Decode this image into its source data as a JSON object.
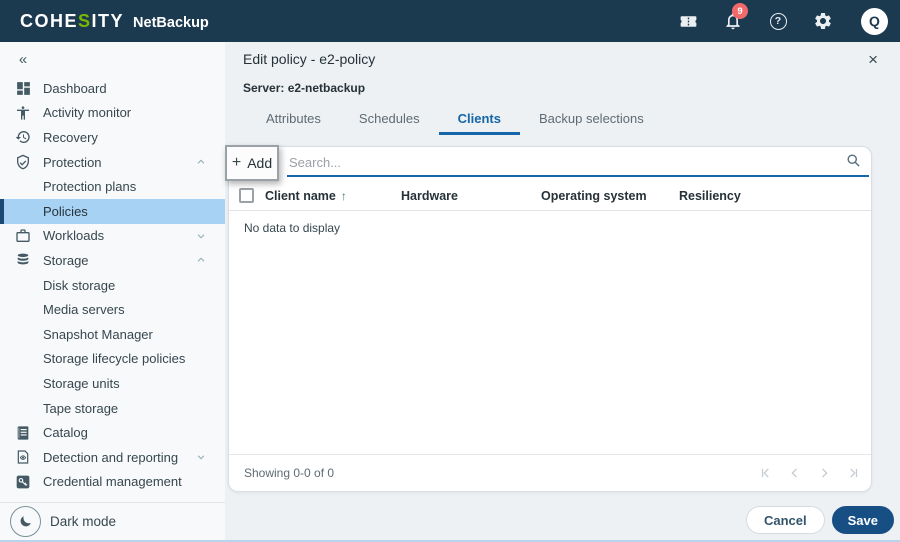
{
  "icons": {
    "collapse": "«",
    "sort_asc": "↑",
    "close": "×",
    "plus": "+",
    "help": "?"
  },
  "topbar": {
    "brand_pre": "COHE",
    "brand_s": "S",
    "brand_post": "ITY",
    "product": "NetBackup",
    "notification_count": "9",
    "avatar_initial": "Q"
  },
  "sidebar": {
    "items": [
      {
        "label": "Dashboard"
      },
      {
        "label": "Activity monitor"
      },
      {
        "label": "Recovery"
      },
      {
        "label": "Protection"
      },
      {
        "label": "Protection plans"
      },
      {
        "label": "Policies"
      },
      {
        "label": "Workloads"
      },
      {
        "label": "Storage"
      },
      {
        "label": "Disk storage"
      },
      {
        "label": "Media servers"
      },
      {
        "label": "Snapshot Manager"
      },
      {
        "label": "Storage lifecycle policies"
      },
      {
        "label": "Storage units"
      },
      {
        "label": "Tape storage"
      },
      {
        "label": "Catalog"
      },
      {
        "label": "Detection and reporting"
      },
      {
        "label": "Credential management"
      }
    ],
    "dark_mode_label": "Dark mode"
  },
  "panel": {
    "title": "Edit policy - e2-policy",
    "server": "Server: e2-netbackup",
    "tabs": [
      {
        "label": "Attributes"
      },
      {
        "label": "Schedules"
      },
      {
        "label": "Clients"
      },
      {
        "label": "Backup selections"
      }
    ],
    "add_label": "Add",
    "search_placeholder": "Search...",
    "table": {
      "columns": [
        "Client name",
        "Hardware",
        "Operating system",
        "Resiliency"
      ],
      "empty": "No data to display"
    },
    "showing": "Showing 0-0 of 0",
    "cancel_label": "Cancel",
    "save_label": "Save"
  }
}
